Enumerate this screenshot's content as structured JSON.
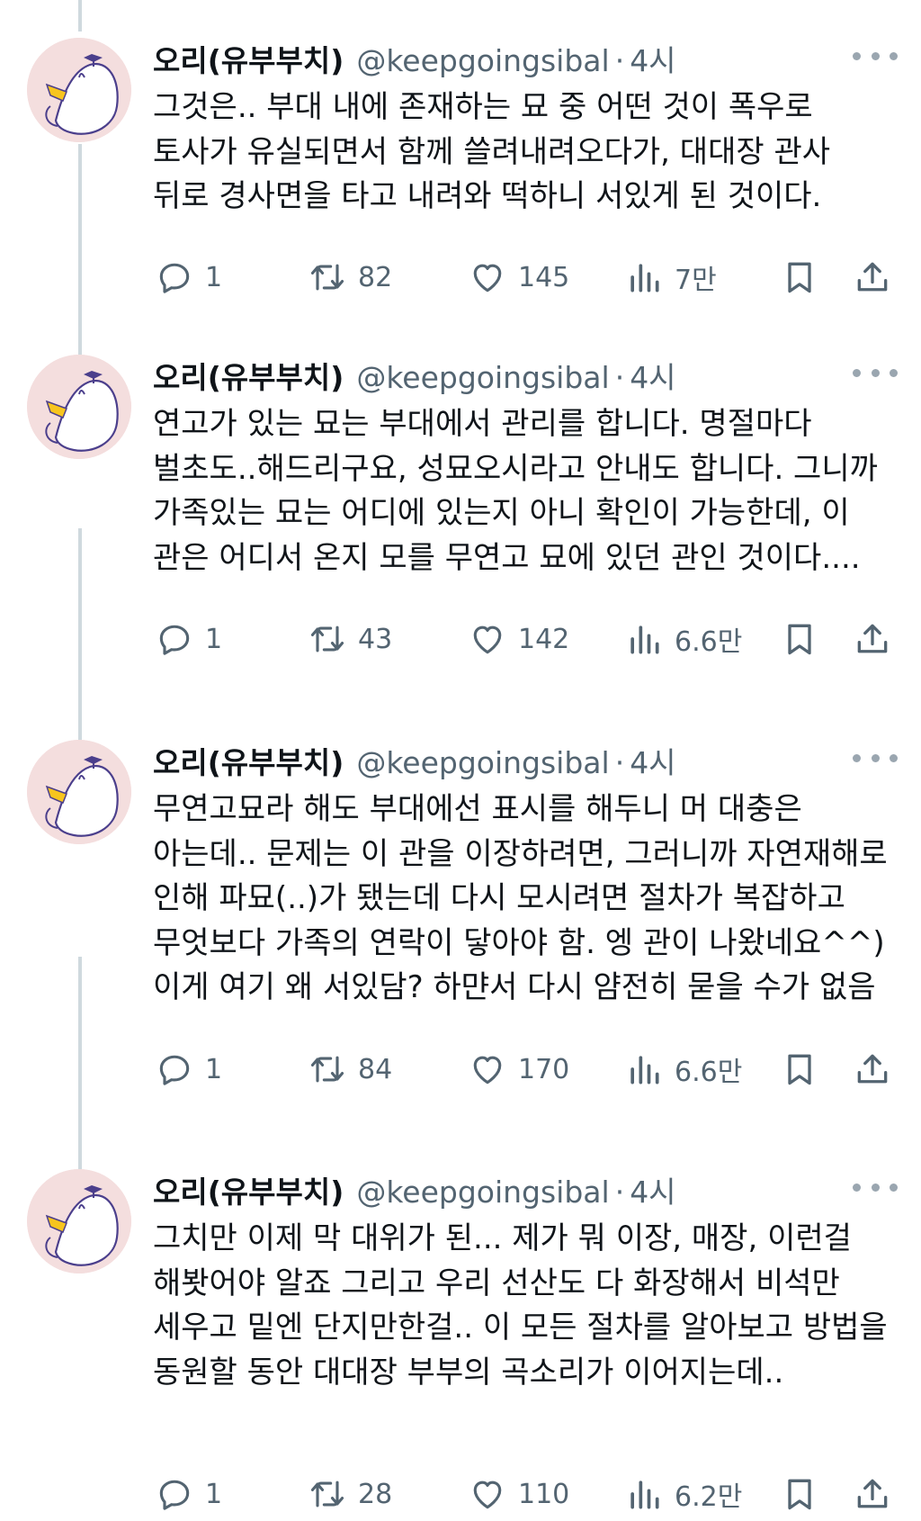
{
  "tweets": [
    {
      "display_name": "오리(유부부치)",
      "handle": "@keepgoingsibal",
      "separator": "·",
      "time": "4시",
      "text": "그것은.. 부대 내에 존재하는 묘 중 어떤 것이 폭우로 토사가 유실되면서 함께 쓸려내려오다가, 대대장 관사 뒤로 경사면을 타고 내려와 떡하니 서있게 된 것이다.",
      "replies": "1",
      "retweets": "82",
      "likes": "145",
      "views": "7만"
    },
    {
      "display_name": "오리(유부부치)",
      "handle": "@keepgoingsibal",
      "separator": "·",
      "time": "4시",
      "text": "연고가 있는 묘는 부대에서 관리를 합니다. 명절마다 벌초도..해드리구요, 성묘오시라고 안내도 합니다. 그니까 가족있는 묘는 어디에 있는지 아니 확인이 가능한데, 이 관은 어디서 온지 모를 무연고 묘에 있던 관인 것이다....",
      "replies": "1",
      "retweets": "43",
      "likes": "142",
      "views": "6.6만"
    },
    {
      "display_name": "오리(유부부치)",
      "handle": "@keepgoingsibal",
      "separator": "·",
      "time": "4시",
      "text": "무연고묘라 해도 부대에선 표시를 해두니 머 대충은 아는데.. 문제는 이 관을 이장하려면, 그러니까 자연재해로 인해 파묘(..)가 됐는데 다시 모시려면 절차가 복잡하고 무엇보다 가족의 연락이 닿아야 함. 엥 관이 나왔네요^^) 이게 여기 왜 서있담? 하먄서 다시 얌전히 묻을 수가 없음",
      "replies": "1",
      "retweets": "84",
      "likes": "170",
      "views": "6.6만"
    },
    {
      "display_name": "오리(유부부치)",
      "handle": "@keepgoingsibal",
      "separator": "·",
      "time": "4시",
      "text": "그치만 이제 막 대위가 된... 제가 뭐 이장, 매장, 이런걸 해봣어야 알죠 그리고 우리 선산도 다 화장해서 비석만 세우고 밑엔 단지만한걸.. 이 모든 절차를 알아보고 방법을 동원할 동안 대대장 부부의 곡소리가 이어지는데..",
      "replies": "1",
      "retweets": "28",
      "likes": "110",
      "views": "6.2만"
    }
  ],
  "icons": {
    "reply": "speech-bubble-icon",
    "retweet": "retweet-arrows-icon",
    "like": "heart-icon",
    "views": "bar-chart-icon",
    "bookmark": "bookmark-icon",
    "share": "share-upload-icon",
    "more": "more-dots-icon"
  },
  "colors": {
    "text_primary": "#0f1419",
    "text_secondary": "#536471",
    "thread_line": "#cfd9de",
    "avatar_bg": "#f4dede",
    "duck_beak": "#f7c51e"
  }
}
